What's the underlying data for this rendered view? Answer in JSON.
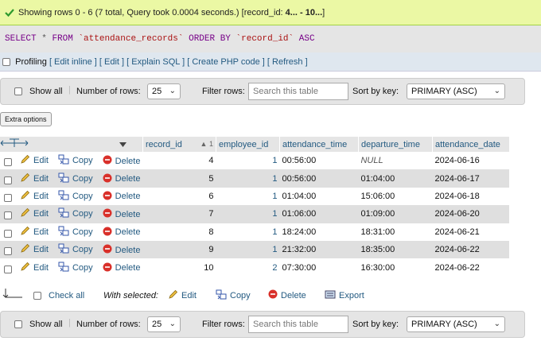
{
  "message": "Showing rows 0 - 6 (7 total, Query took 0.0004 seconds.) [record_id: ",
  "message_bold": "4... - 10...",
  "message_end": "]",
  "sql": {
    "select": "SELECT",
    "star": "*",
    "from": "FROM",
    "table": "`attendance_records`",
    "orderby": "ORDER BY",
    "col": "`record_id`",
    "asc": "ASC"
  },
  "sql_options": {
    "profiling": "Profiling",
    "links": [
      "[ Edit inline ]",
      "[ Edit ]",
      "[ Explain SQL ]",
      "[ Create PHP code ]",
      "[ Refresh ]"
    ]
  },
  "nav": {
    "show_all": "Show all",
    "number_of_rows_label": "Number of rows:",
    "number_of_rows_value": "25",
    "filter_rows_label": "Filter rows:",
    "search_placeholder": "Search this table",
    "sort_by_key_label": "Sort by key:",
    "sort_by_key_value": "PRIMARY (ASC)"
  },
  "extra_options": "Extra options",
  "table": {
    "headers": [
      "record_id",
      "employee_id",
      "attendance_time",
      "departure_time",
      "attendance_date"
    ],
    "sort_indicator": "1",
    "actions": {
      "edit": "Edit",
      "copy": "Copy",
      "delete": "Delete"
    },
    "rows": [
      {
        "record_id": "4",
        "employee_id": "1",
        "attendance_time": "00:56:00",
        "departure_time": "NULL",
        "attendance_date": "2024-06-16"
      },
      {
        "record_id": "5",
        "employee_id": "1",
        "attendance_time": "00:56:00",
        "departure_time": "01:04:00",
        "attendance_date": "2024-06-17"
      },
      {
        "record_id": "6",
        "employee_id": "1",
        "attendance_time": "01:04:00",
        "departure_time": "15:06:00",
        "attendance_date": "2024-06-18"
      },
      {
        "record_id": "7",
        "employee_id": "1",
        "attendance_time": "01:06:00",
        "departure_time": "01:09:00",
        "attendance_date": "2024-06-20"
      },
      {
        "record_id": "8",
        "employee_id": "1",
        "attendance_time": "18:24:00",
        "departure_time": "18:31:00",
        "attendance_date": "2024-06-21"
      },
      {
        "record_id": "9",
        "employee_id": "1",
        "attendance_time": "21:32:00",
        "departure_time": "18:35:00",
        "attendance_date": "2024-06-22"
      },
      {
        "record_id": "10",
        "employee_id": "2",
        "attendance_time": "07:30:00",
        "departure_time": "16:30:00",
        "attendance_date": "2024-06-22"
      }
    ]
  },
  "bulk": {
    "check_all": "Check all",
    "with_selected": "With selected:",
    "edit": "Edit",
    "copy": "Copy",
    "delete": "Delete",
    "export": "Export"
  },
  "colors": {
    "accent": "#235a81",
    "success_bg": "#ebf8a4",
    "row_alt": "#dfdfdf"
  }
}
